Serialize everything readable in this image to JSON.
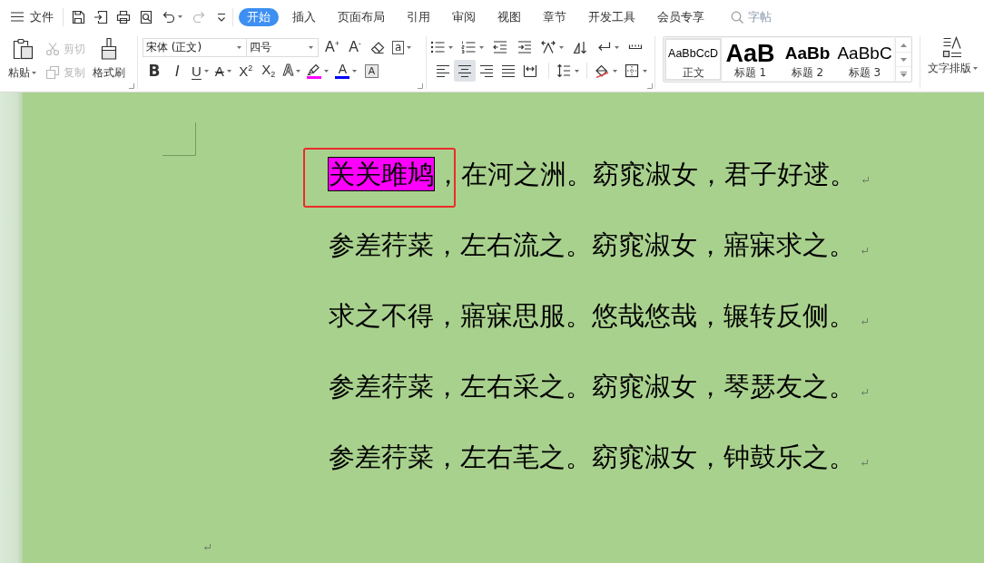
{
  "menu_bar": {
    "file_menu": "文件",
    "quick_access": [
      {
        "kind": "save",
        "disabled": false
      },
      {
        "kind": "export",
        "disabled": false
      },
      {
        "kind": "print",
        "disabled": false
      },
      {
        "kind": "print_preview",
        "disabled": false
      },
      {
        "kind": "undo",
        "disabled": false
      },
      {
        "kind": "redo",
        "disabled": true
      },
      {
        "kind": "customize",
        "disabled": false
      }
    ],
    "tabs": [
      {
        "label": "开始",
        "selected": true
      },
      {
        "label": "插入",
        "selected": false
      },
      {
        "label": "页面布局",
        "selected": false
      },
      {
        "label": "引用",
        "selected": false
      },
      {
        "label": "审阅",
        "selected": false
      },
      {
        "label": "视图",
        "selected": false
      },
      {
        "label": "章节",
        "selected": false
      },
      {
        "label": "开发工具",
        "selected": false
      },
      {
        "label": "会员专享",
        "selected": false
      }
    ],
    "search": {
      "placeholder": "字帖"
    }
  },
  "ribbon": {
    "clipboard": {
      "paste": {
        "label": "粘贴",
        "disabled": false
      },
      "cut": {
        "label": "剪切",
        "disabled": true
      },
      "copy": {
        "label": "复制",
        "disabled": true
      },
      "format_painter": {
        "label": "格式刷",
        "disabled": false
      }
    },
    "font": {
      "font_name": "宋体 (正文)",
      "font_size": "四号",
      "row_1": [
        {
          "kind": "grow_font",
          "glyph": "A$^{+}$"
        },
        {
          "kind": "shrink_font",
          "glyph": "A$^{-}$"
        },
        {
          "kind": "clear_format"
        },
        {
          "kind": "enclose",
          "glyph": "a"
        }
      ],
      "row_2": [
        {
          "kind": "bold",
          "glyph": "B"
        },
        {
          "kind": "italic",
          "glyph": "I"
        },
        {
          "kind": "underline",
          "glyph": "U"
        },
        {
          "kind": "strikethrough",
          "glyph": "A"
        },
        {
          "kind": "superscript",
          "glyph": "X$^{2}$"
        },
        {
          "kind": "subscript",
          "glyph": "X$_{2}$"
        },
        {
          "kind": "text_effect",
          "glyph": "A"
        },
        {
          "kind": "highlight",
          "color": "#ff00ff"
        },
        {
          "kind": "font_color",
          "glyph": "A",
          "color": "#0000ff"
        },
        {
          "kind": "char_shading",
          "glyph": "A"
        }
      ]
    },
    "paragraph": {
      "row_1": [
        {
          "kind": "bullets"
        },
        {
          "kind": "numbering"
        },
        {
          "kind": "decrease_indent"
        },
        {
          "kind": "increase_indent"
        },
        {
          "kind": "asian_layout"
        },
        {
          "kind": "sort"
        },
        {
          "kind": "formatting_marks"
        },
        {
          "kind": "tab_stops"
        }
      ],
      "alignment": [
        {
          "kind": "left",
          "selected": false
        },
        {
          "kind": "center",
          "selected": true
        },
        {
          "kind": "right",
          "selected": false
        },
        {
          "kind": "justify",
          "selected": false
        },
        {
          "kind": "distributed",
          "selected": false
        }
      ],
      "row_2_tools": [
        {
          "kind": "line_spacing"
        },
        {
          "kind": "shading"
        },
        {
          "kind": "borders"
        }
      ]
    },
    "styles": [
      {
        "kind": "body",
        "preview": "AaBbCcD",
        "name": "正文",
        "selected": true
      },
      {
        "kind": "heading1",
        "preview": "AaB",
        "name": "标题 1",
        "selected": false
      },
      {
        "kind": "heading2",
        "preview": "AaBb",
        "name": "标题 2",
        "selected": false
      },
      {
        "kind": "heading3",
        "preview": "AaBbC",
        "name": "标题 3",
        "selected": false
      }
    ],
    "text_layout": {
      "label": "文字排版"
    }
  },
  "document": {
    "show_formatting_marks": true,
    "paragraphs": [
      {
        "runs": [
          {
            "text": "关关雎鸠",
            "highlighted": true,
            "annotated": true
          },
          {
            "text": "，在河之洲。窈窕淑女，君子好逑。",
            "highlighted": false,
            "annotated": false
          }
        ]
      },
      {
        "runs": [
          {
            "text": "参差荇菜，左右流之。窈窕淑女，寤寐求之。",
            "highlighted": false,
            "annotated": false
          }
        ]
      },
      {
        "runs": [
          {
            "text": "求之不得，寤寐思服。悠哉悠哉，辗转反侧。",
            "highlighted": false,
            "annotated": false
          }
        ]
      },
      {
        "runs": [
          {
            "text": "参差荇菜，左右采之。窈窕淑女，琴瑟友之。",
            "highlighted": false,
            "annotated": false
          }
        ]
      },
      {
        "runs": [
          {
            "text": "参差荇菜，左右芼之。窈窕淑女，钟鼓乐之。",
            "highlighted": false,
            "annotated": false
          }
        ]
      }
    ]
  }
}
